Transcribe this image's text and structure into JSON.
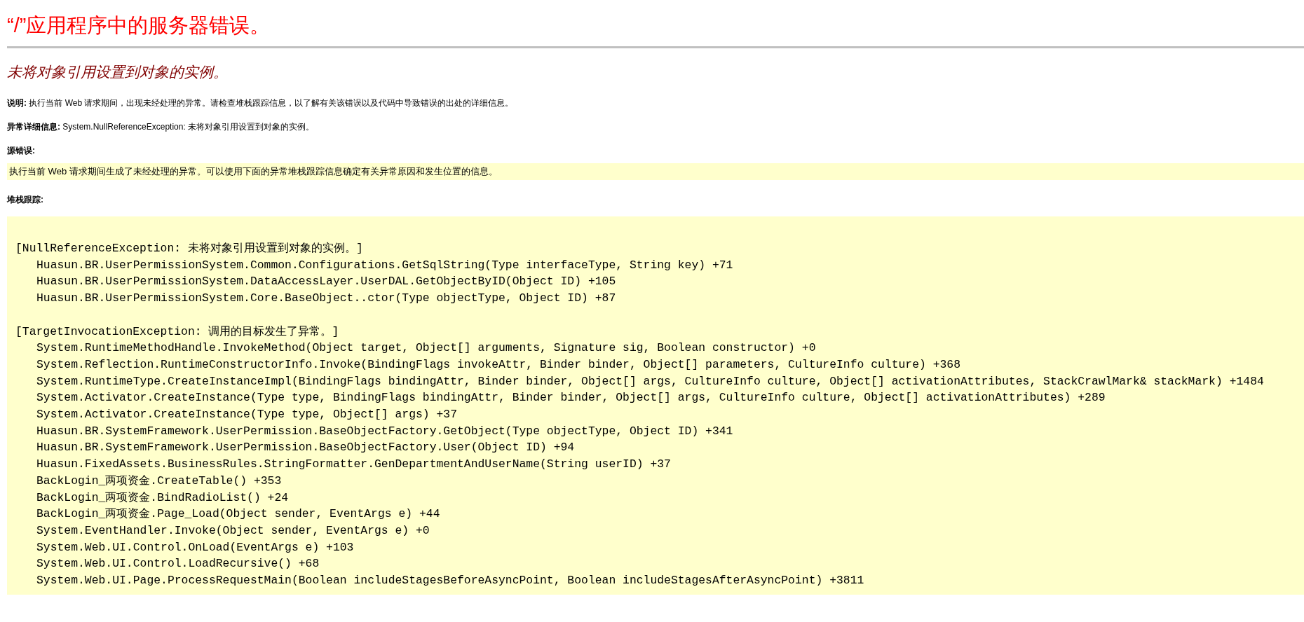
{
  "title": "“/”应用程序中的服务器错误。",
  "subtitle": "未将对象引用设置到对象的实例。",
  "description": {
    "label": "说明:",
    "text": "执行当前 Web 请求期间，出现未经处理的异常。请检查堆栈跟踪信息，以了解有关该错误以及代码中导致错误的出处的详细信息。"
  },
  "exception_details": {
    "label": "异常详细信息:",
    "text": "System.NullReferenceException: 未将对象引用设置到对象的实例。"
  },
  "source_error": {
    "label": "源错误:",
    "text": "执行当前 Web 请求期间生成了未经处理的异常。可以使用下面的异常堆栈跟踪信息确定有关异常原因和发生位置的信息。"
  },
  "stack_trace": {
    "label": "堆栈跟踪:",
    "blocks": [
      {
        "header": "[NullReferenceException: 未将对象引用设置到对象的实例。]",
        "frames": [
          "Huasun.BR.UserPermissionSystem.Common.Configurations.GetSqlString(Type interfaceType, String key) +71",
          "Huasun.BR.UserPermissionSystem.DataAccessLayer.UserDAL.GetObjectByID(Object ID) +105",
          "Huasun.BR.UserPermissionSystem.Core.BaseObject..ctor(Type objectType, Object ID) +87"
        ]
      },
      {
        "header": "[TargetInvocationException: 调用的目标发生了异常。]",
        "frames": [
          "System.RuntimeMethodHandle.InvokeMethod(Object target, Object[] arguments, Signature sig, Boolean constructor) +0",
          "System.Reflection.RuntimeConstructorInfo.Invoke(BindingFlags invokeAttr, Binder binder, Object[] parameters, CultureInfo culture) +368",
          "System.RuntimeType.CreateInstanceImpl(BindingFlags bindingAttr, Binder binder, Object[] args, CultureInfo culture, Object[] activationAttributes, StackCrawlMark& stackMark) +1484",
          "System.Activator.CreateInstance(Type type, BindingFlags bindingAttr, Binder binder, Object[] args, CultureInfo culture, Object[] activationAttributes) +289",
          "System.Activator.CreateInstance(Type type, Object[] args) +37",
          "Huasun.BR.SystemFramework.UserPermission.BaseObjectFactory.GetObject(Type objectType, Object ID) +341",
          "Huasun.BR.SystemFramework.UserPermission.BaseObjectFactory.User(Object ID) +94",
          "Huasun.FixedAssets.BusinessRules.StringFormatter.GenDepartmentAndUserName(String userID) +37",
          "BackLogin_两项资金.CreateTable() +353",
          "BackLogin_两项资金.BindRadioList() +24",
          "BackLogin_两项资金.Page_Load(Object sender, EventArgs e) +44",
          "System.EventHandler.Invoke(Object sender, EventArgs e) +0",
          "System.Web.UI.Control.OnLoad(EventArgs e) +103",
          "System.Web.UI.Control.LoadRecursive() +68",
          "System.Web.UI.Page.ProcessRequestMain(Boolean includeStagesBeforeAsyncPoint, Boolean includeStagesAfterAsyncPoint) +3811"
        ]
      }
    ]
  }
}
